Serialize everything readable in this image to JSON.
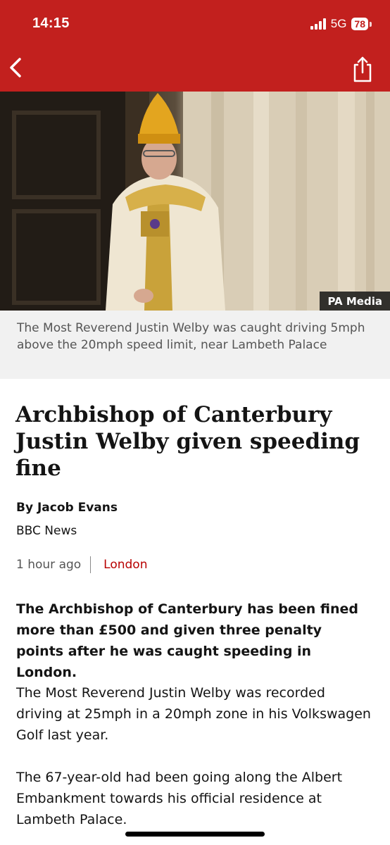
{
  "status_bar": {
    "time": "14:15",
    "network": "5G",
    "battery": "78"
  },
  "hero": {
    "credit": "PA Media",
    "caption": "The Most Reverend Justin Welby was caught driving 5mph above the 20mph speed limit, near Lambeth Palace"
  },
  "article": {
    "title": "Archbishop of Canterbury Justin Welby given speeding fine",
    "byline": "By Jacob Evans",
    "organisation": "BBC News",
    "time_ago": "1 hour ago",
    "location": "London",
    "lede": "The Archbishop of Canterbury has been fined more than £500 and given three penalty points after he was caught speeding in London.",
    "paragraphs": [
      "The Most Reverend Justin Welby was recorded driving at 25mph in a 20mph zone in his Volkswagen Golf last year.",
      "The 67-year-old had been going along the Albert Embankment towards his official residence at Lambeth Palace."
    ]
  },
  "colors": {
    "brand_red": "#c2201e",
    "location_red": "#b80000"
  },
  "icons": {
    "back": "chevron-left-icon",
    "share": "share-icon"
  }
}
